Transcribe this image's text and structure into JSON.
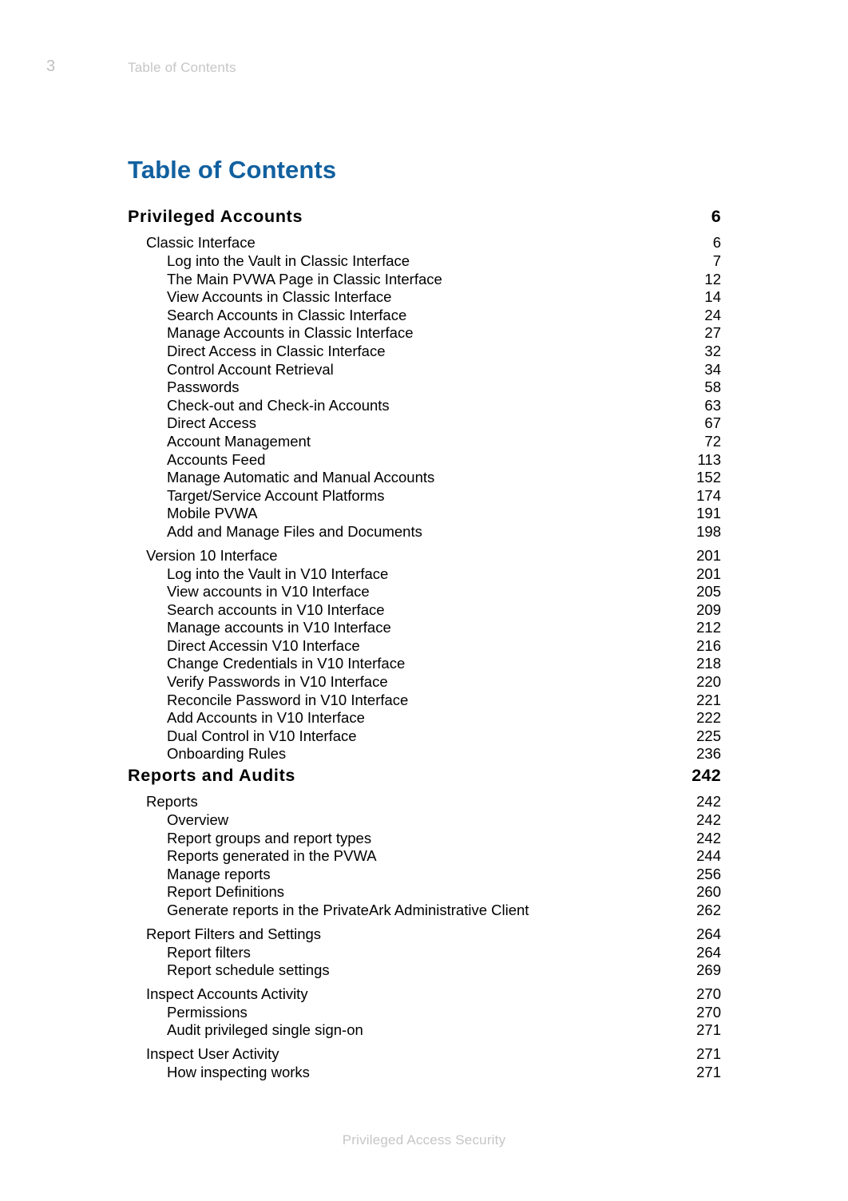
{
  "header": {
    "page_number": "3",
    "label": "Table of Contents"
  },
  "title": "Table of Contents",
  "footer": {
    "text": "Privileged Access Security"
  },
  "colors": {
    "title_blue": "#11609f",
    "body_text": "#000000",
    "header_gray": "#c6c6c6",
    "page_number_gray": "#bfbfbf",
    "background": "#ffffff"
  },
  "toc": {
    "entries": [
      {
        "level": 1,
        "title": "Privileged Accounts",
        "page": "6"
      },
      {
        "level": 2,
        "title": "Classic Interface",
        "page": "6"
      },
      {
        "level": 3,
        "title": "Log into the Vault in Classic Interface",
        "page": "7"
      },
      {
        "level": 3,
        "title": "The Main PVWA Page in Classic Interface",
        "page": "12"
      },
      {
        "level": 3,
        "title": "View Accounts in Classic Interface",
        "page": "14"
      },
      {
        "level": 3,
        "title": "Search Accounts in Classic Interface",
        "page": "24"
      },
      {
        "level": 3,
        "title": "Manage Accounts in Classic Interface",
        "page": "27"
      },
      {
        "level": 3,
        "title": "Direct Access in Classic Interface",
        "page": "32"
      },
      {
        "level": 3,
        "title": "Control Account Retrieval",
        "page": "34"
      },
      {
        "level": 3,
        "title": "Passwords",
        "page": "58"
      },
      {
        "level": 3,
        "title": "Check-out and Check-in Accounts",
        "page": "63"
      },
      {
        "level": 3,
        "title": "Direct Access",
        "page": "67"
      },
      {
        "level": 3,
        "title": "Account Management",
        "page": "72"
      },
      {
        "level": 3,
        "title": "Accounts Feed",
        "page": "113"
      },
      {
        "level": 3,
        "title": "Manage Automatic and Manual Accounts",
        "page": "152"
      },
      {
        "level": 3,
        "title": "Target/Service Account Platforms",
        "page": "174"
      },
      {
        "level": 3,
        "title": "Mobile PVWA",
        "page": "191"
      },
      {
        "level": 3,
        "title": "Add and Manage Files and Documents",
        "page": "198"
      },
      {
        "level": 2,
        "title": "Version 10 Interface",
        "page": "201"
      },
      {
        "level": 3,
        "title": "Log into the Vault in V10 Interface",
        "page": "201"
      },
      {
        "level": 3,
        "title": "View accounts in V10 Interface",
        "page": "205"
      },
      {
        "level": 3,
        "title": "Search accounts in V10 Interface",
        "page": "209"
      },
      {
        "level": 3,
        "title": "Manage accounts in V10 Interface",
        "page": "212"
      },
      {
        "level": 3,
        "title": "Direct Accessin V10 Interface",
        "page": "216"
      },
      {
        "level": 3,
        "title": "Change Credentials in V10 Interface",
        "page": "218"
      },
      {
        "level": 3,
        "title": "Verify Passwords in V10 Interface",
        "page": "220"
      },
      {
        "level": 3,
        "title": "Reconcile Password in V10 Interface",
        "page": "221"
      },
      {
        "level": 3,
        "title": "Add Accounts in V10 Interface",
        "page": "222"
      },
      {
        "level": 3,
        "title": "Dual Control in V10 Interface",
        "page": "225"
      },
      {
        "level": 3,
        "title": "Onboarding Rules",
        "page": "236"
      },
      {
        "level": 1,
        "title": "Reports and Audits",
        "page": "242"
      },
      {
        "level": 2,
        "title": "Reports",
        "page": "242"
      },
      {
        "level": 3,
        "title": "Overview",
        "page": "242"
      },
      {
        "level": 3,
        "title": "Report groups and report types",
        "page": "242"
      },
      {
        "level": 3,
        "title": "Reports generated in the PVWA",
        "page": "244"
      },
      {
        "level": 3,
        "title": "Manage reports",
        "page": "256"
      },
      {
        "level": 3,
        "title": "Report Definitions",
        "page": "260"
      },
      {
        "level": 3,
        "title": "Generate reports in the PrivateArk Administrative Client",
        "page": "262"
      },
      {
        "level": 2,
        "title": "Report Filters and Settings",
        "page": "264"
      },
      {
        "level": 3,
        "title": "Report filters",
        "page": "264"
      },
      {
        "level": 3,
        "title": "Report schedule settings",
        "page": "269"
      },
      {
        "level": 2,
        "title": "Inspect Accounts Activity",
        "page": "270"
      },
      {
        "level": 3,
        "title": "Permissions",
        "page": "270"
      },
      {
        "level": 3,
        "title": "Audit privileged single sign-on",
        "page": "271"
      },
      {
        "level": 2,
        "title": "Inspect User Activity",
        "page": "271"
      },
      {
        "level": 3,
        "title": "How inspecting works",
        "page": "271"
      }
    ]
  }
}
